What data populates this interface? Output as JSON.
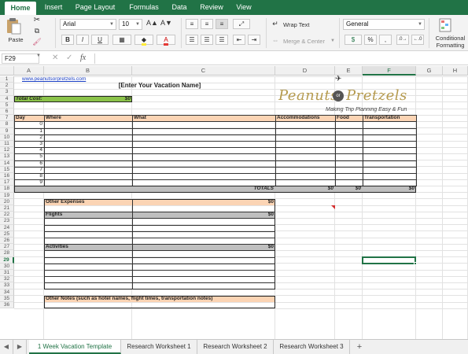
{
  "ribbon_tabs": [
    "Home",
    "Insert",
    "Page Layout",
    "Formulas",
    "Data",
    "Review",
    "View"
  ],
  "ribbon": {
    "paste": "Paste",
    "font_name": "Arial",
    "font_size": "10",
    "bold": "B",
    "italic": "I",
    "underline": "U",
    "wrap_text": "Wrap Text",
    "merge_center": "Merge & Center",
    "number_format": "General",
    "conditional_formatting_1": "Conditional",
    "conditional_formatting_2": "Formatting"
  },
  "formula_bar": {
    "name_box": "F29",
    "fx": "fx",
    "content": ""
  },
  "columns": [
    "A",
    "B",
    "C",
    "D",
    "E",
    "F",
    "G",
    "H"
  ],
  "rows": [
    "1",
    "2",
    "3",
    "4",
    "5",
    "6",
    "7",
    "8",
    "9",
    "10",
    "11",
    "12",
    "13",
    "14",
    "15",
    "16",
    "17",
    "18",
    "19",
    "20",
    "21",
    "22",
    "23",
    "24",
    "25",
    "26",
    "27",
    "28",
    "29",
    "30",
    "31",
    "32",
    "33",
    "34",
    "35",
    "36"
  ],
  "sheet": {
    "website": "www.peanutsorpretzels.com",
    "title": "[Enter Your Vacation Name]",
    "total_cost_label": "Total Cost:",
    "total_cost_value": "$0",
    "logo_word1": "Peanuts",
    "logo_or": "or",
    "logo_word2": "Pretzels",
    "tagline": "Making Trip Planning Easy & Fun",
    "headers": {
      "day": "Day",
      "where": "Where",
      "what": "What",
      "accommodations": "Accommodations",
      "food": "Food",
      "transportation": "Transportation"
    },
    "days": [
      "0",
      "1",
      "2",
      "3",
      "4",
      "5",
      "6",
      "7",
      "8",
      "9"
    ],
    "totals_label": "TOTALS",
    "totals": {
      "accommodations": "$0",
      "food": "$0",
      "transportation": "$0"
    },
    "other_expenses_label": "Other Expenses",
    "other_expenses_value": "$0",
    "flights_label": "Flights",
    "flights_value": "$0",
    "activities_label": "Activities",
    "activities_value": "$0",
    "other_notes_label": "Other Notes (such as hotel names, flight times, transportation notes)"
  },
  "sheet_tabs": [
    "1 Week Vacation Template",
    "Research Worksheet 1",
    "Research Worksheet 2",
    "Research Worksheet 3"
  ],
  "add_sheet": "+",
  "colors": {
    "excel_green": "#217346",
    "orange": "#fbd4b4",
    "gray": "#bfbfbf",
    "lime": "#8bc34a",
    "logo_gold": "#b59a4e"
  }
}
